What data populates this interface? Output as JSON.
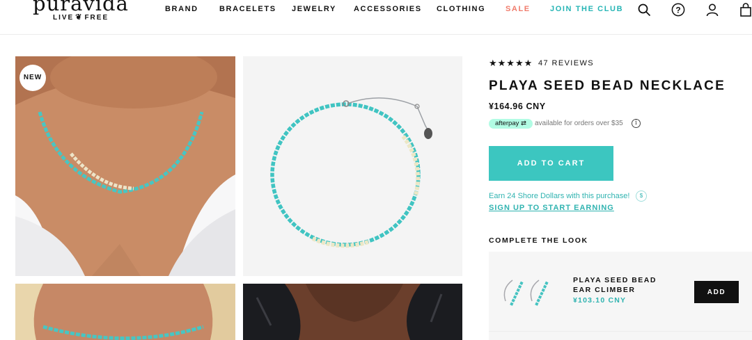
{
  "header": {
    "logo_word": "puravida",
    "logo_tagline_left": "LIVE",
    "logo_tagline_right": "FREE",
    "nav": [
      {
        "label": "BRAND"
      },
      {
        "label": "BRACELETS"
      },
      {
        "label": "JEWELRY"
      },
      {
        "label": "ACCESSORIES"
      },
      {
        "label": "CLOTHING"
      },
      {
        "label": "SALE"
      },
      {
        "label": "JOIN THE CLUB"
      }
    ],
    "icons": [
      "search-icon",
      "help-icon",
      "account-icon",
      "cart-icon"
    ]
  },
  "gallery": {
    "badge": "NEW"
  },
  "product": {
    "rating": "★★★★★",
    "reviews_label": "47 REVIEWS",
    "title": "PLAYA SEED BEAD NECKLACE",
    "price": "¥164.96 CNY",
    "afterpay_label": "afterpay",
    "afterpay_text": "available for orders over $35",
    "add_to_cart_label": "ADD TO CART",
    "shore_text": "Earn 24 Shore Dollars with this purchase!",
    "signup_label": "SIGN UP TO START EARNING"
  },
  "complete_the_look": {
    "heading": "COMPLETE THE LOOK",
    "item": {
      "name": "PLAYA SEED BEAD EAR CLIMBER",
      "price": "¥103.10 CNY",
      "add_label": "ADD"
    }
  },
  "colors": {
    "accent": "#3cc6c0",
    "sale": "#f07b6b",
    "link": "#2fb3b0",
    "afterpay": "#b2fce4"
  }
}
